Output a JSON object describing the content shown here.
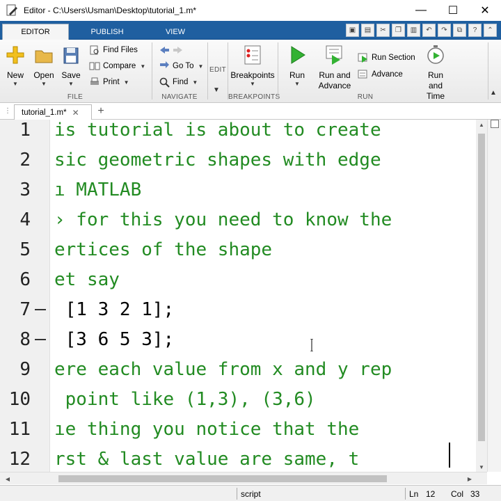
{
  "window": {
    "title": "Editor - C:\\Users\\Usman\\Desktop\\tutorial_1.m*",
    "minimize": "—",
    "maximize": "☐",
    "close": "✕"
  },
  "ribbon_tabs": [
    "EDITOR",
    "PUBLISH",
    "VIEW"
  ],
  "ribbon": {
    "file": {
      "label": "FILE",
      "new": "New",
      "open": "Open",
      "save": "Save",
      "find_files": "Find Files",
      "compare": "Compare",
      "print": "Print"
    },
    "navigate": {
      "label": "NAVIGATE",
      "go_to": "Go To",
      "find": "Find"
    },
    "edit": {
      "label": "EDIT"
    },
    "breakpoints": {
      "label": "BREAKPOINTS",
      "breakpoints": "Breakpoints"
    },
    "run": {
      "label": "RUN",
      "run": "Run",
      "run_and_advance_1": "Run and",
      "run_and_advance_2": "Advance",
      "run_section": "Run Section",
      "advance": "Advance",
      "run_and_time_1": "Run and",
      "run_and_time_2": "Time"
    }
  },
  "document_tab": {
    "name": "tutorial_1.m*",
    "close": "✕",
    "add": "+"
  },
  "editor": {
    "lines": [
      {
        "num": "1",
        "text": "is tutorial is about to create",
        "type": "comment",
        "marker": false
      },
      {
        "num": "2",
        "text": "sic geometric shapes with edge",
        "type": "comment",
        "marker": false
      },
      {
        "num": "3",
        "text": "ı MATLAB",
        "type": "comment",
        "marker": false
      },
      {
        "num": "4",
        "text": "› for this you need to know the",
        "type": "comment",
        "marker": false
      },
      {
        "num": "5",
        "text": "ertices of the shape",
        "type": "comment",
        "marker": false
      },
      {
        "num": "6",
        "text": "et say",
        "type": "comment",
        "marker": false
      },
      {
        "num": "7",
        "text": " [1 3 2 1];",
        "type": "normal",
        "marker": true
      },
      {
        "num": "8",
        "text": " [3 6 5 3];",
        "type": "normal",
        "marker": true
      },
      {
        "num": "9",
        "text": "ere each value from x and y rep",
        "type": "comment",
        "marker": false
      },
      {
        "num": "10",
        "text": " point like (1,3), (3,6)",
        "type": "comment",
        "marker": false
      },
      {
        "num": "11",
        "text": "ıe thing you notice that the",
        "type": "comment",
        "marker": false
      },
      {
        "num": "12",
        "text": "rst & last value are same, t",
        "type": "comment",
        "marker": false
      }
    ]
  },
  "status": {
    "mode": "script",
    "ln_label": "Ln",
    "ln_value": "12",
    "col_label": "Col",
    "col_value": "33"
  },
  "colors": {
    "ribbon_blue": "#1f5fa0",
    "comment_green": "#228b22"
  }
}
